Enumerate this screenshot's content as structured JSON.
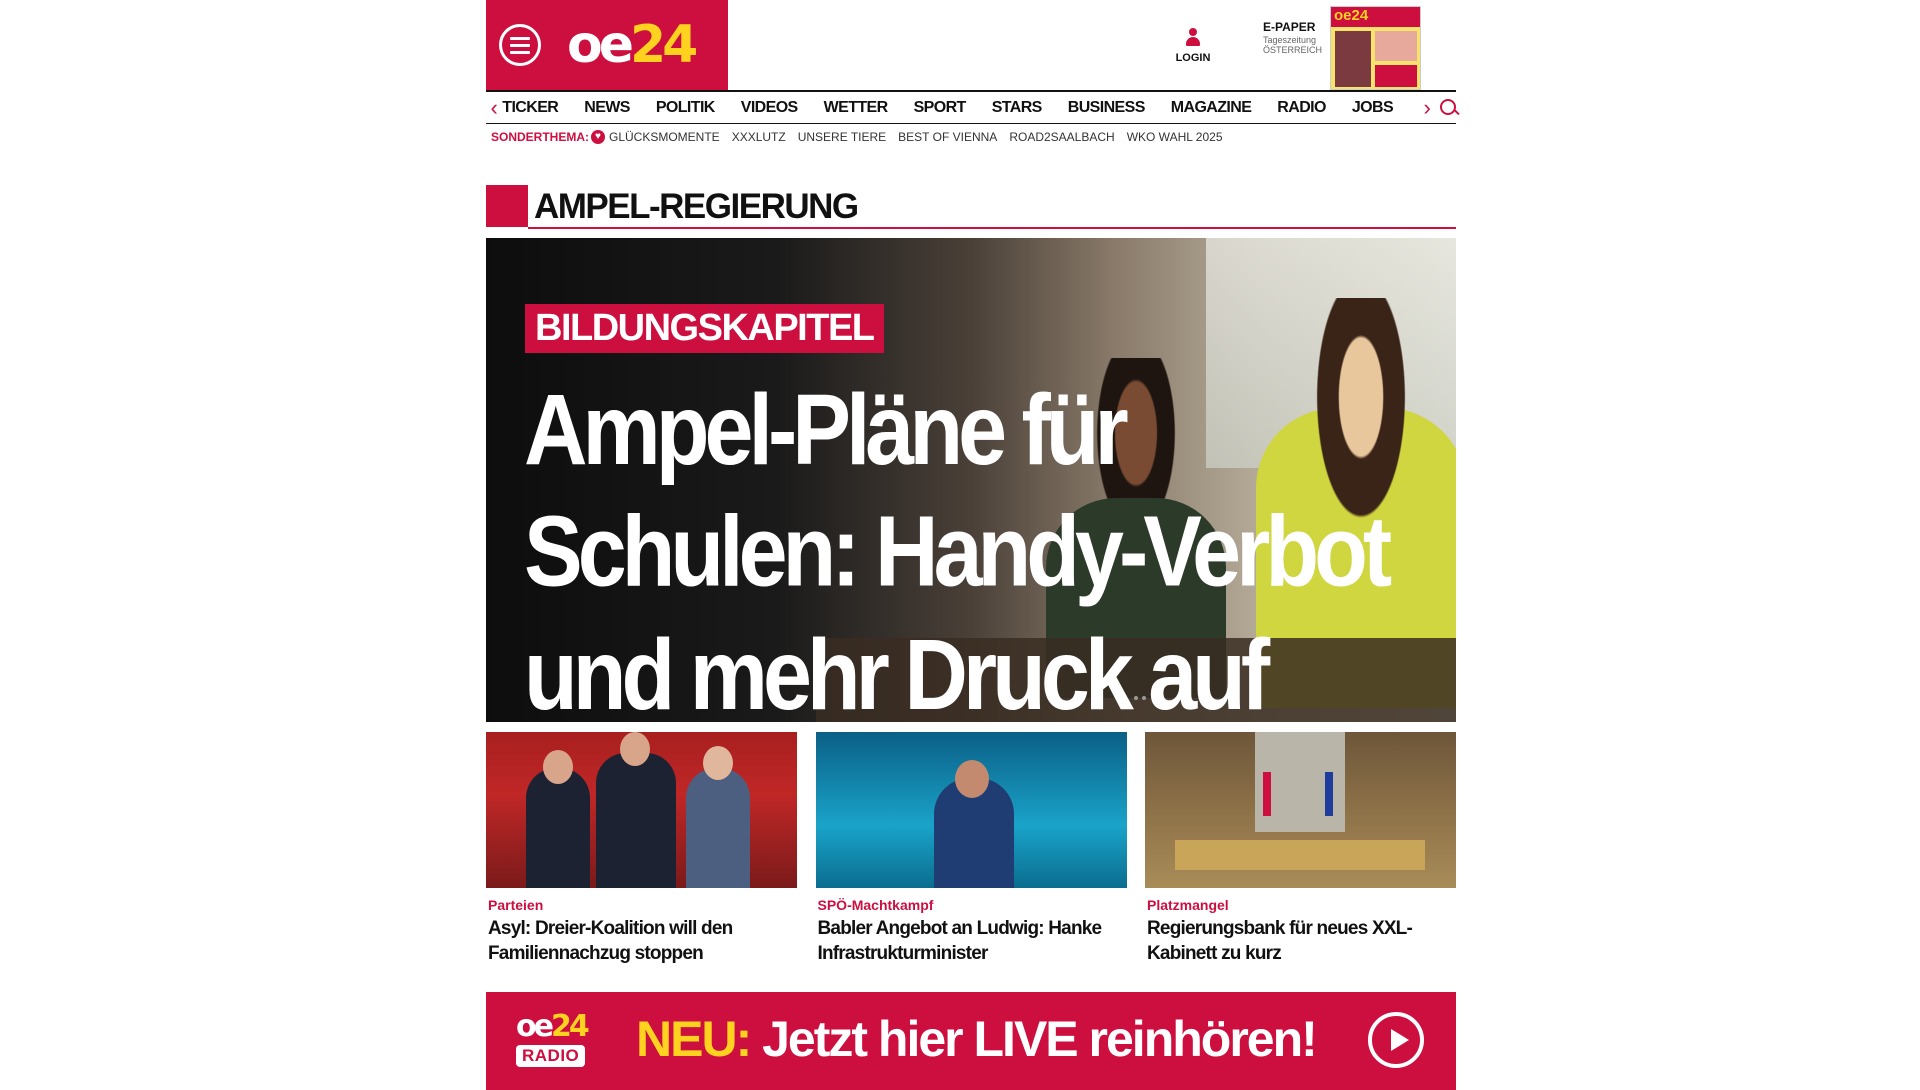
{
  "brand": {
    "logo_oe": "oe",
    "logo_num": "24",
    "red": "#cc0f3f",
    "yellow": "#ffd21f"
  },
  "header": {
    "login_label": "LOGIN",
    "epaper": {
      "title": "E-PAPER",
      "line2": "Tageszeitung",
      "line3": "ÖSTERREICH",
      "cover_logo": "oe24"
    }
  },
  "nav": {
    "prev_icon": "‹",
    "next_icon": "›",
    "items": [
      "TICKER",
      "NEWS",
      "POLITIK",
      "VIDEOS",
      "WETTER",
      "SPORT",
      "STARS",
      "BUSINESS",
      "MAGAZINE",
      "RADIO",
      "JOBS"
    ]
  },
  "subnav": {
    "lead": "SONDERTHEMA:",
    "items": [
      "GLÜCKSMOMENTE",
      "XXXLUTZ",
      "UNSERE TIERE",
      "BEST OF VIENNA",
      "ROAD2SAALBACH",
      "WKO WAHL 2025"
    ]
  },
  "section": {
    "title": "AMPEL-REGIERUNG"
  },
  "hero": {
    "kicker": "BILDUNGSKAPITEL",
    "headline": "Ampel-Pläne für Schulen: Handy-Verbot und mehr Druck auf Eltern"
  },
  "teasers": [
    {
      "kicker": "Parteien",
      "title": "Asyl: Dreier-Koalition will den Familiennachzug stoppen"
    },
    {
      "kicker": "SPÖ-Machtkampf",
      "title": "Babler Angebot an Ludwig: Hanke Infrastrukturminister"
    },
    {
      "kicker": "Platzmangel",
      "title": "Regierungsbank für neues XXL-Kabinett zu kurz"
    }
  ],
  "radio_banner": {
    "logo_oe": "oe",
    "logo_num": "24",
    "logo_radio": "RADIO",
    "neu": "NEU:",
    "text": " Jetzt hier LIVE reinhören!"
  }
}
